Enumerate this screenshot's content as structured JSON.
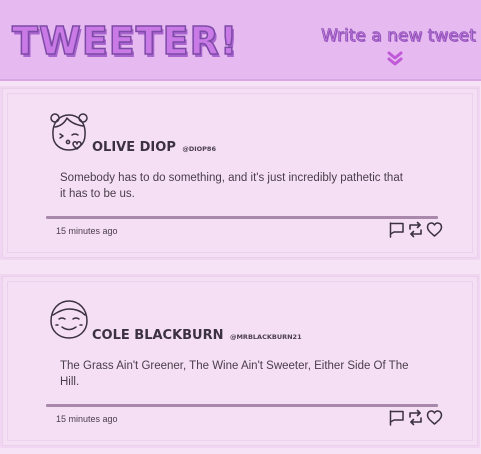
{
  "header": {
    "logo": "TWEETER!",
    "write_label": "Write a new tweet"
  },
  "tweets": [
    {
      "name": "OLIVE DIOP",
      "handle": "@DIOP86",
      "content": "Somebody has to do something, and it's just incredibly pathetic that it has to be us.",
      "time": "15 minutes ago",
      "avatar_icon": "girl-avatar-icon"
    },
    {
      "name": "COLE BLACKBURN",
      "handle": "@MRBLACKBURN21",
      "content": "The Grass Ain't Greener, The Wine Ain't Sweeter, Either Side Of The Hill.",
      "time": "15 minutes ago",
      "avatar_icon": "boy-avatar-icon"
    }
  ],
  "icons": [
    "flag-icon",
    "retweet-icon",
    "heart-icon"
  ],
  "colors": {
    "header_bg": "#e7b9f1",
    "page_bg": "#f6e3f6",
    "accent": "#c97ae6",
    "accent_dark": "#7d4aa6"
  }
}
